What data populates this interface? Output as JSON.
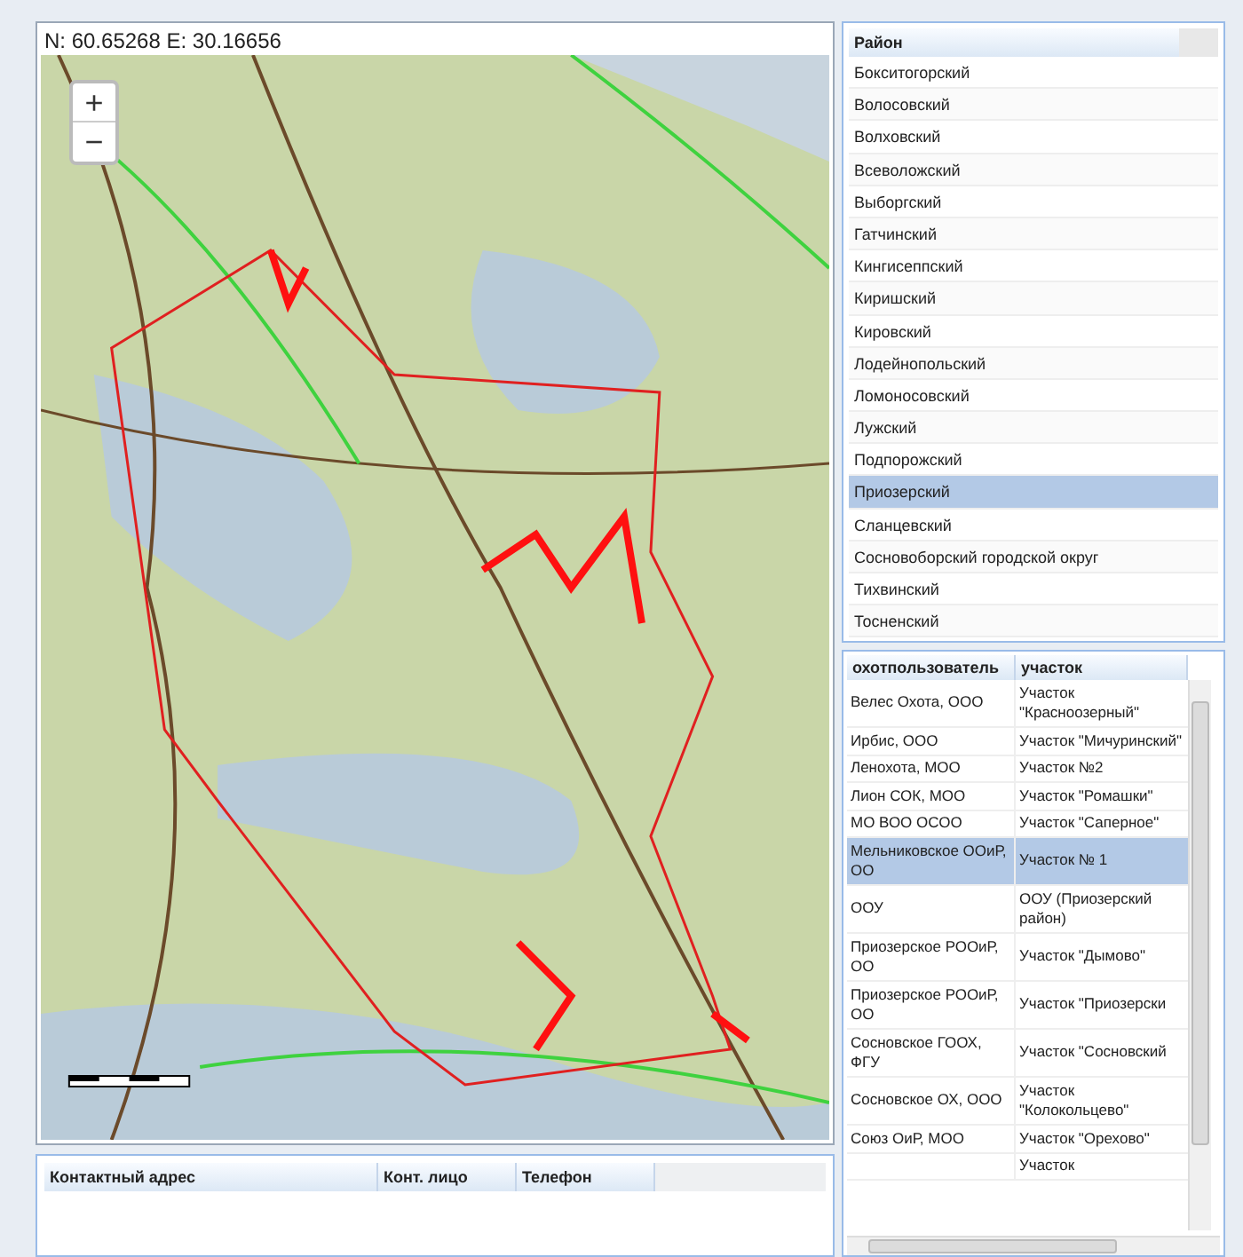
{
  "map": {
    "coordinates": "N: 60.65268 E: 30.16656",
    "zoom_in": "+",
    "zoom_out": "−"
  },
  "contacts_table": {
    "columns": [
      "Контактный адрес",
      "Конт. лицо",
      "Телефон"
    ]
  },
  "districts": {
    "column": "Район",
    "rows": [
      {
        "name": "Бокситогорский",
        "selected": false
      },
      {
        "name": "Волосовский",
        "selected": false
      },
      {
        "name": "Волховский",
        "selected": false
      },
      {
        "name": "Всеволожский",
        "selected": false
      },
      {
        "name": "Выборгский",
        "selected": false
      },
      {
        "name": "Гатчинский",
        "selected": false
      },
      {
        "name": "Кингисеппский",
        "selected": false
      },
      {
        "name": "Киришский",
        "selected": false
      },
      {
        "name": "Кировский",
        "selected": false
      },
      {
        "name": "Лодейнопольский",
        "selected": false
      },
      {
        "name": "Ломоносовский",
        "selected": false
      },
      {
        "name": "Лужский",
        "selected": false
      },
      {
        "name": "Подпорожский",
        "selected": false
      },
      {
        "name": "Приозерский",
        "selected": true
      },
      {
        "name": "Сланцевский",
        "selected": false
      },
      {
        "name": "Сосновоборский городской округ",
        "selected": false
      },
      {
        "name": "Тихвинский",
        "selected": false
      },
      {
        "name": "Тосненский",
        "selected": false
      }
    ]
  },
  "hunting_grounds": {
    "columns": [
      "охотпользователь",
      "участок"
    ],
    "rows": [
      {
        "user": "Велес Охота, ООО",
        "parcel": "Участок \"Красноозерный\"",
        "selected": false
      },
      {
        "user": "Ирбис, ООО",
        "parcel": "Участок \"Мичуринский\"",
        "selected": false
      },
      {
        "user": "Ленохота, МОО",
        "parcel": "Участок №2",
        "selected": false
      },
      {
        "user": "Лион СОК, МОО",
        "parcel": "Участок \"Ромашки\"",
        "selected": false
      },
      {
        "user": "МО ВОО ОСОО",
        "parcel": "Участок \"Саперное\"",
        "selected": false
      },
      {
        "user": "Мельниковское ООиР, ОО",
        "parcel": "Участок № 1",
        "selected": true
      },
      {
        "user": "ООУ",
        "parcel": "ООУ (Приозерский район)",
        "selected": false
      },
      {
        "user": "Приозерское РООиР, ОО",
        "parcel": "Участок \"Дымово\"",
        "selected": false
      },
      {
        "user": "Приозерское РООиР, ОО",
        "parcel": "Участок \"Приозерски",
        "selected": false
      },
      {
        "user": "Сосновское ГООХ, ФГУ",
        "parcel": "Участок \"Сосновский",
        "selected": false
      },
      {
        "user": "Сосновское ОХ, ООО",
        "parcel": "Участок \"Колокольцево\"",
        "selected": false
      },
      {
        "user": "Союз ОиР, МОО",
        "parcel": "Участок \"Орехово\"",
        "selected": false
      },
      {
        "parcel": "Участок",
        "selected": false
      }
    ]
  }
}
